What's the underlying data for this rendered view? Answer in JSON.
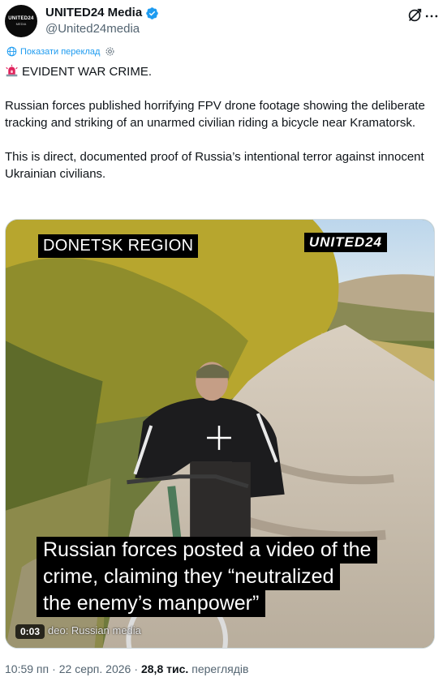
{
  "account": {
    "display_name": "UNITED24 Media",
    "handle": "@United24media",
    "avatar_text": "UNITED24",
    "avatar_subtext": "MEDIA"
  },
  "translate": {
    "label": "Показати переклад"
  },
  "post": {
    "line1": "EVIDENT WAR CRIME.",
    "paragraph2": "Russian forces published horrifying FPV drone footage showing the deliberate tracking and striking of an unarmed civilian riding a bicycle near Kramatorsk.",
    "paragraph3": "This is direct, documented proof of Russia’s intentional terror against innocent Ukrainian civilians."
  },
  "video": {
    "region_label": "DONETSK REGION",
    "brand_label": "UNITED24",
    "caption_line1": "Russian forces posted a video of the",
    "caption_line2": "crime, claiming they “neutralized",
    "caption_line3": "the enemy’s manpower”",
    "source_text": "deo: Russian media",
    "timer": "0:03"
  },
  "meta": {
    "time": "10:59 пп",
    "separator": "·",
    "date": "22 серп. 2026",
    "views_count": "28,8 тис.",
    "views_label": "переглядів"
  },
  "colors": {
    "link": "#1d9bf0",
    "secondary": "#536471",
    "verified": "#1d9bf0"
  }
}
